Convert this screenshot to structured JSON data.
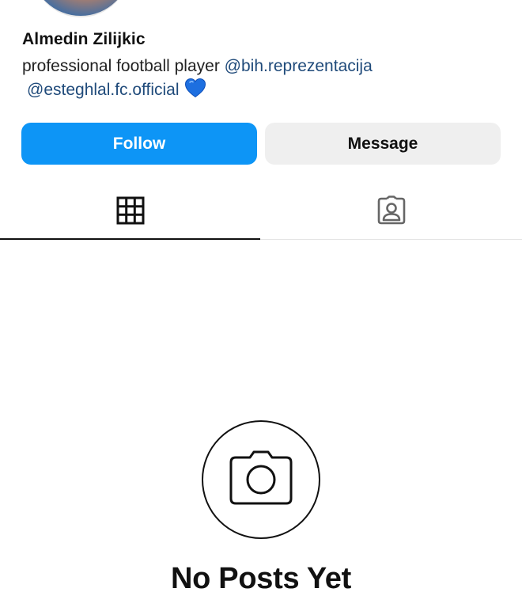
{
  "profile": {
    "name": "Almedin Zilijkic",
    "bio": {
      "text": "professional football player",
      "mention_1": "@bih.reprezentacija",
      "mention_2": "@esteghlal.fc.official",
      "emoji": "blue-heart-icon"
    }
  },
  "actions": {
    "follow_label": "Follow",
    "message_label": "Message"
  },
  "tabs": [
    {
      "id": "posts",
      "icon": "grid-icon",
      "active": true
    },
    {
      "id": "tagged",
      "icon": "tagged-person-icon",
      "active": false
    }
  ],
  "empty_state": {
    "icon": "camera-icon",
    "title": "No Posts Yet"
  },
  "colors": {
    "follow_button": "#0d95f6",
    "message_button": "#efefef",
    "mention_text": "#1f4a7a",
    "heart": "#1d6fe0"
  }
}
